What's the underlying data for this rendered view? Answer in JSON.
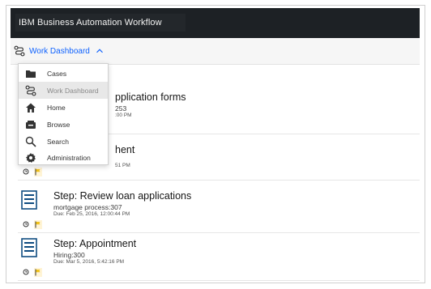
{
  "app": {
    "title": "IBM Business Automation Workflow"
  },
  "dashboard_switcher": {
    "label": "Work Dashboard"
  },
  "menu": {
    "items": [
      {
        "label": "Cases",
        "icon": "folder-icon"
      },
      {
        "label": "Work Dashboard",
        "icon": "workflow-icon",
        "active": true
      },
      {
        "label": "Home",
        "icon": "home-icon"
      },
      {
        "label": "Browse",
        "icon": "browse-icon"
      },
      {
        "label": "Search",
        "icon": "search-icon"
      },
      {
        "label": "Administration",
        "icon": "gear-icon"
      }
    ]
  },
  "tasks": [
    {
      "title": "pplication forms",
      "subtitle": "253",
      "due": ":00 PM"
    },
    {
      "title": "hent",
      "subtitle": "",
      "due": "51 PM"
    },
    {
      "title": "Step: Review loan applications",
      "subtitle": "mortgage process:307",
      "due": "Due: Feb 25, 2016, 12:00:44 PM"
    },
    {
      "title": "Step: Appointment",
      "subtitle": "Hiring:300",
      "due": "Due: Mar 5, 2016, 5:42:16 PM"
    }
  ],
  "colors": {
    "header_bg": "#1d2125",
    "link": "#0f62fe",
    "flag": "#f1c21b",
    "doc_icon": "#0f4c81"
  }
}
